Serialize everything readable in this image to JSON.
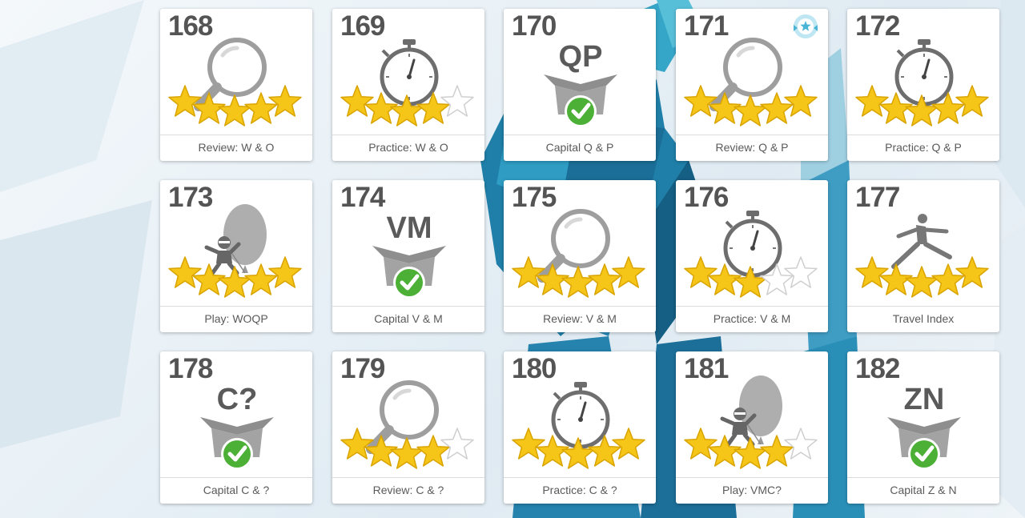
{
  "colors": {
    "star": "#f5c518",
    "check": "#4caf36",
    "icon_gray": "#9e9e9e",
    "text": "#545454"
  },
  "tiles": [
    {
      "number": "168",
      "icon": "magnifier-icon",
      "stars": 5,
      "label": "Review: W & O"
    },
    {
      "number": "169",
      "icon": "stopwatch-icon",
      "stars": 4,
      "label": "Practice: W & O"
    },
    {
      "number": "170",
      "icon": "box-icon",
      "letters": "QP",
      "label": "Capital Q & P"
    },
    {
      "number": "171",
      "icon": "magnifier-icon",
      "stars": 5,
      "badge": "award-badge-icon",
      "label": "Review: Q & P"
    },
    {
      "number": "172",
      "icon": "stopwatch-icon",
      "stars": 5,
      "label": "Practice: Q & P"
    },
    {
      "number": "173",
      "icon": "balloon-ninja-icon",
      "stars": 5,
      "label": "Play: WOQP"
    },
    {
      "number": "174",
      "icon": "box-icon",
      "letters": "VM",
      "label": "Capital V & M"
    },
    {
      "number": "175",
      "icon": "magnifier-icon",
      "stars": 5,
      "label": "Review: V & M"
    },
    {
      "number": "176",
      "icon": "stopwatch-icon",
      "stars": 3,
      "label": "Practice: V & M"
    },
    {
      "number": "177",
      "icon": "runner-icon",
      "stars": 5,
      "label": "Travel Index"
    },
    {
      "number": "178",
      "icon": "box-icon",
      "letters": "C?",
      "label": "Capital C & ?"
    },
    {
      "number": "179",
      "icon": "magnifier-icon",
      "stars": 4,
      "label": "Review: C & ?"
    },
    {
      "number": "180",
      "icon": "stopwatch-icon",
      "stars": 5,
      "label": "Practice: C & ?"
    },
    {
      "number": "181",
      "icon": "balloon-ninja-icon",
      "stars": 4,
      "label": "Play: VMC?"
    },
    {
      "number": "182",
      "icon": "box-icon",
      "letters": "ZN",
      "label": "Capital Z & N"
    }
  ]
}
